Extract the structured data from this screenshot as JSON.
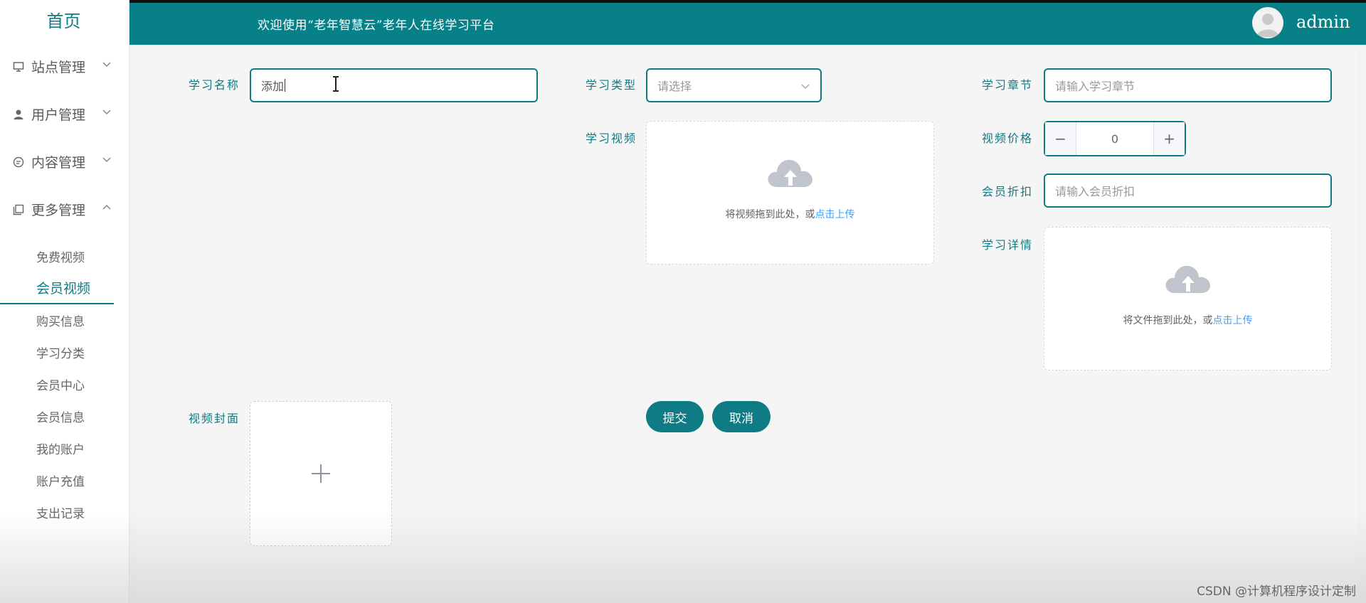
{
  "sidebar": {
    "home": "首页",
    "menus": [
      {
        "label": "站点管理",
        "icon": "monitor-icon"
      },
      {
        "label": "用户管理",
        "icon": "user-icon"
      },
      {
        "label": "内容管理",
        "icon": "chat-icon"
      },
      {
        "label": "更多管理",
        "icon": "copy-icon"
      }
    ],
    "sub_items": [
      "免费视频",
      "会员视频",
      "购买信息",
      "学习分类",
      "会员中心",
      "会员信息",
      "我的账户",
      "账户充值",
      "支出记录"
    ],
    "active_sub": "会员视频"
  },
  "header": {
    "welcome": "欢迎使用“老年智慧云”老年人在线学习平台",
    "username": "admin"
  },
  "form": {
    "name": {
      "label": "学习名称",
      "value": "添加"
    },
    "type": {
      "label": "学习类型",
      "placeholder": "请选择"
    },
    "chapter": {
      "label": "学习章节",
      "placeholder": "请输入学习章节"
    },
    "video": {
      "label": "学习视频",
      "hint_prefix": "将视频拖到此处，或",
      "hint_link": "点击上传"
    },
    "price": {
      "label": "视频价格",
      "value": "0"
    },
    "discount": {
      "label": "会员折扣",
      "placeholder": "请输入会员折扣"
    },
    "detail": {
      "label": "学习详情",
      "hint_prefix": "将文件拖到此处，或",
      "hint_link": "点击上传"
    },
    "cover": {
      "label": "视频封面"
    },
    "submit": "提交",
    "cancel": "取消"
  },
  "watermark": "CSDN @计算机程序设计定制",
  "colors": {
    "primary": "#0f7b84",
    "header_bg": "#088088",
    "link": "#409eff"
  }
}
